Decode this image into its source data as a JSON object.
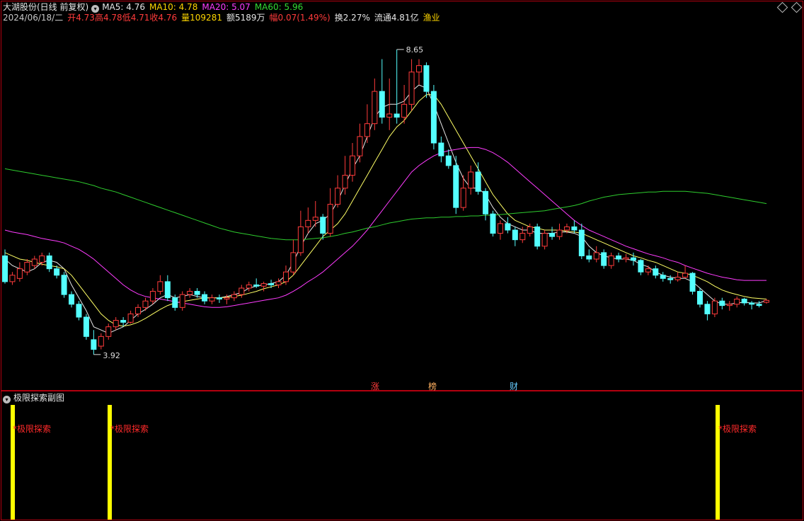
{
  "header": {
    "title": "大湖股份(日线 前复权)",
    "ma5": "MA5: 4.76",
    "ma10": "MA10: 4.78",
    "ma20": "MA20: 5.07",
    "ma60": "MA60: 5.96",
    "date": "2024/06/18/二",
    "open": "开4.73",
    "high": "高4.78",
    "low": "低4.71",
    "close": "收4.76",
    "volume": "量109281",
    "amount": "额5189万",
    "change": "幅0.07(1.49%)",
    "turnover": "换2.27%",
    "float": "流通4.81亿",
    "sector": "渔业"
  },
  "markers": {
    "zhang": "涨",
    "bang": "榜",
    "cai": "财"
  },
  "subchart": {
    "title": "极限探索副图",
    "signal_label": "*极限探索"
  },
  "colors": {
    "up": "#ff3b3b",
    "down": "#54ffff",
    "ma5": "#e8e8e8",
    "ma10": "#ffff66",
    "ma20": "#ff3cff",
    "ma60": "#2ecc2e",
    "signal": "#ffff00",
    "frame": "#b3000f"
  },
  "chart_data": {
    "type": "candlestick",
    "y_range": [
      3.6,
      9.0
    ],
    "annotations": {
      "max": 8.65,
      "min": 3.92
    },
    "candles": [
      [
        5.45,
        5.05,
        5.55,
        5.02
      ],
      [
        5.05,
        5.15,
        5.2,
        5.0
      ],
      [
        5.1,
        5.25,
        5.35,
        5.05
      ],
      [
        5.2,
        5.35,
        5.4,
        5.15
      ],
      [
        5.3,
        5.4,
        5.45,
        5.25
      ],
      [
        5.35,
        5.45,
        5.5,
        5.3
      ],
      [
        5.45,
        5.25,
        5.5,
        5.2
      ],
      [
        5.25,
        5.15,
        5.3,
        5.1
      ],
      [
        5.15,
        4.85,
        5.2,
        4.8
      ],
      [
        4.85,
        4.7,
        4.9,
        4.65
      ],
      [
        4.7,
        4.5,
        4.75,
        4.45
      ],
      [
        4.5,
        4.2,
        4.55,
        4.15
      ],
      [
        4.15,
        4.0,
        4.3,
        3.92
      ],
      [
        4.05,
        4.2,
        4.25,
        4.0
      ],
      [
        4.2,
        4.35,
        4.4,
        4.15
      ],
      [
        4.35,
        4.45,
        4.5,
        4.3
      ],
      [
        4.45,
        4.42,
        4.5,
        4.35
      ],
      [
        4.42,
        4.55,
        4.6,
        4.4
      ],
      [
        4.55,
        4.65,
        4.7,
        4.5
      ],
      [
        4.65,
        4.75,
        4.8,
        4.6
      ],
      [
        4.75,
        4.9,
        4.95,
        4.7
      ],
      [
        4.9,
        5.05,
        5.15,
        4.85
      ],
      [
        5.05,
        4.8,
        5.15,
        4.75
      ],
      [
        4.8,
        4.65,
        4.85,
        4.6
      ],
      [
        4.65,
        4.85,
        4.9,
        4.6
      ],
      [
        4.85,
        4.9,
        4.95,
        4.8
      ],
      [
        4.9,
        4.85,
        4.95,
        4.8
      ],
      [
        4.85,
        4.75,
        4.9,
        4.7
      ],
      [
        4.75,
        4.8,
        4.85,
        4.7
      ],
      [
        4.8,
        4.78,
        4.85,
        4.72
      ],
      [
        4.78,
        4.8,
        4.85,
        4.7
      ],
      [
        4.8,
        4.85,
        4.9,
        4.75
      ],
      [
        4.85,
        4.95,
        5.0,
        4.8
      ],
      [
        4.95,
        5.0,
        5.05,
        4.9
      ],
      [
        5.0,
        4.98,
        5.1,
        4.95
      ],
      [
        4.98,
        5.02,
        5.05,
        4.9
      ],
      [
        5.02,
        5.0,
        5.08,
        4.95
      ],
      [
        5.0,
        5.05,
        5.1,
        4.95
      ],
      [
        5.05,
        5.2,
        5.3,
        5.0
      ],
      [
        5.2,
        5.5,
        5.7,
        5.15
      ],
      [
        5.5,
        5.9,
        6.15,
        5.45
      ],
      [
        5.9,
        6.0,
        6.2,
        5.8
      ],
      [
        6.0,
        6.05,
        6.3,
        5.9
      ],
      [
        6.05,
        5.8,
        6.1,
        5.7
      ],
      [
        5.8,
        6.25,
        6.5,
        5.75
      ],
      [
        6.25,
        6.5,
        6.7,
        6.2
      ],
      [
        6.5,
        6.7,
        7.0,
        6.4
      ],
      [
        6.7,
        7.0,
        7.2,
        6.6
      ],
      [
        7.0,
        7.3,
        7.5,
        6.9
      ],
      [
        7.3,
        7.5,
        7.8,
        7.2
      ],
      [
        7.5,
        8.0,
        8.2,
        7.4
      ],
      [
        8.0,
        7.6,
        8.5,
        7.5
      ],
      [
        7.6,
        7.65,
        8.2,
        7.4
      ],
      [
        7.65,
        7.6,
        8.65,
        7.5
      ],
      [
        7.6,
        7.8,
        8.1,
        7.5
      ],
      [
        7.8,
        8.3,
        8.5,
        7.7
      ],
      [
        8.3,
        8.4,
        8.5,
        8.1
      ],
      [
        8.4,
        8.0,
        8.45,
        7.9
      ],
      [
        8.0,
        7.2,
        8.1,
        7.1
      ],
      [
        7.2,
        7.0,
        7.3,
        6.9
      ],
      [
        7.0,
        6.85,
        7.1,
        6.8
      ],
      [
        6.85,
        6.2,
        7.0,
        6.1
      ],
      [
        6.2,
        6.5,
        6.7,
        6.15
      ],
      [
        6.5,
        6.75,
        6.85,
        6.4
      ],
      [
        6.75,
        6.45,
        6.9,
        6.4
      ],
      [
        6.45,
        6.1,
        6.5,
        6.0
      ],
      [
        6.1,
        5.8,
        6.15,
        5.75
      ],
      [
        5.8,
        5.95,
        6.0,
        5.7
      ],
      [
        5.95,
        5.85,
        6.05,
        5.8
      ],
      [
        5.85,
        5.7,
        5.9,
        5.6
      ],
      [
        5.7,
        5.8,
        5.9,
        5.65
      ],
      [
        5.8,
        5.9,
        5.95,
        5.75
      ],
      [
        5.9,
        5.6,
        5.95,
        5.55
      ],
      [
        5.6,
        5.8,
        5.85,
        5.55
      ],
      [
        5.8,
        5.75,
        5.9,
        5.7
      ],
      [
        5.75,
        5.85,
        5.95,
        5.7
      ],
      [
        5.85,
        5.9,
        5.95,
        5.8
      ],
      [
        5.9,
        5.85,
        6.0,
        5.8
      ],
      [
        5.85,
        5.45,
        5.95,
        5.4
      ],
      [
        5.45,
        5.4,
        5.55,
        5.35
      ],
      [
        5.4,
        5.5,
        5.6,
        5.35
      ],
      [
        5.5,
        5.3,
        5.55,
        5.25
      ],
      [
        5.3,
        5.45,
        5.5,
        5.25
      ],
      [
        5.45,
        5.4,
        5.5,
        5.35
      ],
      [
        5.4,
        5.42,
        5.48,
        5.35
      ],
      [
        5.42,
        5.38,
        5.5,
        5.3
      ],
      [
        5.38,
        5.2,
        5.4,
        5.15
      ],
      [
        5.2,
        5.25,
        5.3,
        5.15
      ],
      [
        5.25,
        5.15,
        5.3,
        5.1
      ],
      [
        5.15,
        5.1,
        5.2,
        5.05
      ],
      [
        5.1,
        5.08,
        5.15,
        5.02
      ],
      [
        5.08,
        5.12,
        5.2,
        5.05
      ],
      [
        5.12,
        5.18,
        5.3,
        5.1
      ],
      [
        5.18,
        4.9,
        5.2,
        4.85
      ],
      [
        4.9,
        4.7,
        4.95,
        4.65
      ],
      [
        4.7,
        4.55,
        4.75,
        4.45
      ],
      [
        4.55,
        4.75,
        4.8,
        4.5
      ],
      [
        4.75,
        4.68,
        4.8,
        4.62
      ],
      [
        4.68,
        4.7,
        4.75,
        4.6
      ],
      [
        4.7,
        4.78,
        4.82,
        4.65
      ],
      [
        4.78,
        4.72,
        4.8,
        4.68
      ],
      [
        4.72,
        4.7,
        4.75,
        4.62
      ],
      [
        4.7,
        4.68,
        4.75,
        4.65
      ],
      [
        4.73,
        4.76,
        4.78,
        4.71
      ]
    ],
    "ma_lines": [
      {
        "name": "MA5",
        "values": [
          5.4,
          5.3,
          5.25,
          5.2,
          5.25,
          5.35,
          5.38,
          5.35,
          5.25,
          5.0,
          4.8,
          4.6,
          4.35,
          4.3,
          4.25,
          4.3,
          4.35,
          4.45,
          4.55,
          4.62,
          4.7,
          4.8,
          4.85,
          4.8,
          4.82,
          4.85,
          4.82,
          4.8,
          4.8,
          4.8,
          4.82,
          4.85,
          4.88,
          4.95,
          4.98,
          5.0,
          5.02,
          5.05,
          5.15,
          5.35,
          5.6,
          5.8,
          5.95,
          6.0,
          6.1,
          6.3,
          6.55,
          6.8,
          7.0,
          7.3,
          7.6,
          7.75,
          7.8,
          7.8,
          7.85,
          8.0,
          8.1,
          8.05,
          7.8,
          7.5,
          7.2,
          6.9,
          6.65,
          6.5,
          6.5,
          6.4,
          6.2,
          6.05,
          5.95,
          5.9,
          5.85,
          5.85,
          5.8,
          5.8,
          5.8,
          5.82,
          5.82,
          5.8,
          5.75,
          5.6,
          5.5,
          5.45,
          5.42,
          5.4,
          5.4,
          5.38,
          5.32,
          5.28,
          5.2,
          5.15,
          5.12,
          5.1,
          5.1,
          5.05,
          4.95,
          4.85,
          4.75,
          4.7,
          4.7,
          4.72,
          4.73,
          4.72,
          4.72,
          4.76
        ]
      },
      {
        "name": "MA10",
        "values": [
          5.5,
          5.45,
          5.4,
          5.38,
          5.35,
          5.32,
          5.3,
          5.28,
          5.25,
          5.15,
          5.0,
          4.85,
          4.7,
          4.55,
          4.45,
          4.38,
          4.36,
          4.38,
          4.42,
          4.48,
          4.55,
          4.62,
          4.68,
          4.72,
          4.74,
          4.76,
          4.78,
          4.8,
          4.8,
          4.8,
          4.81,
          4.82,
          4.84,
          4.87,
          4.9,
          4.94,
          4.97,
          5.0,
          5.05,
          5.15,
          5.3,
          5.45,
          5.6,
          5.75,
          5.85,
          5.95,
          6.1,
          6.3,
          6.5,
          6.7,
          6.9,
          7.1,
          7.3,
          7.45,
          7.55,
          7.7,
          7.85,
          7.95,
          7.95,
          7.8,
          7.6,
          7.4,
          7.2,
          7.0,
          6.8,
          6.6,
          6.4,
          6.25,
          6.1,
          6.0,
          5.95,
          5.9,
          5.88,
          5.85,
          5.85,
          5.85,
          5.83,
          5.82,
          5.8,
          5.75,
          5.7,
          5.65,
          5.6,
          5.55,
          5.5,
          5.45,
          5.42,
          5.38,
          5.35,
          5.3,
          5.25,
          5.2,
          5.18,
          5.15,
          5.1,
          5.05,
          4.98,
          4.92,
          4.88,
          4.85,
          4.82,
          4.8,
          4.79,
          4.78
        ]
      },
      {
        "name": "MA20",
        "values": [
          5.85,
          5.82,
          5.8,
          5.78,
          5.75,
          5.72,
          5.7,
          5.68,
          5.65,
          5.6,
          5.55,
          5.48,
          5.4,
          5.3,
          5.2,
          5.1,
          5.0,
          4.92,
          4.86,
          4.82,
          4.8,
          4.78,
          4.76,
          4.74,
          4.72,
          4.7,
          4.68,
          4.66,
          4.65,
          4.65,
          4.66,
          4.68,
          4.7,
          4.72,
          4.74,
          4.76,
          4.78,
          4.8,
          4.84,
          4.9,
          4.97,
          5.05,
          5.12,
          5.2,
          5.3,
          5.4,
          5.5,
          5.6,
          5.72,
          5.85,
          6.0,
          6.15,
          6.3,
          6.45,
          6.6,
          6.75,
          6.85,
          6.93,
          7.0,
          7.05,
          7.08,
          7.1,
          7.12,
          7.13,
          7.13,
          7.1,
          7.05,
          6.98,
          6.9,
          6.8,
          6.7,
          6.6,
          6.5,
          6.4,
          6.3,
          6.2,
          6.1,
          6.0,
          5.92,
          5.85,
          5.8,
          5.75,
          5.7,
          5.65,
          5.6,
          5.56,
          5.52,
          5.48,
          5.45,
          5.42,
          5.38,
          5.35,
          5.3,
          5.26,
          5.22,
          5.18,
          5.15,
          5.12,
          5.1,
          5.08,
          5.07,
          5.07,
          5.07,
          5.07
        ]
      },
      {
        "name": "MA60",
        "values": [
          6.8,
          6.78,
          6.76,
          6.74,
          6.72,
          6.7,
          6.68,
          6.66,
          6.64,
          6.62,
          6.6,
          6.57,
          6.54,
          6.5,
          6.47,
          6.44,
          6.4,
          6.36,
          6.32,
          6.28,
          6.24,
          6.2,
          6.16,
          6.12,
          6.08,
          6.04,
          6.0,
          5.96,
          5.92,
          5.88,
          5.85,
          5.82,
          5.8,
          5.78,
          5.76,
          5.74,
          5.72,
          5.71,
          5.7,
          5.7,
          5.7,
          5.71,
          5.72,
          5.73,
          5.75,
          5.77,
          5.8,
          5.82,
          5.85,
          5.88,
          5.9,
          5.93,
          5.96,
          5.98,
          6.0,
          6.02,
          6.03,
          6.04,
          6.04,
          6.05,
          6.05,
          6.06,
          6.06,
          6.07,
          6.07,
          6.08,
          6.08,
          6.09,
          6.1,
          6.11,
          6.12,
          6.13,
          6.14,
          6.15,
          6.17,
          6.19,
          6.21,
          6.23,
          6.26,
          6.3,
          6.33,
          6.36,
          6.38,
          6.4,
          6.41,
          6.42,
          6.43,
          6.44,
          6.44,
          6.45,
          6.45,
          6.45,
          6.45,
          6.44,
          6.43,
          6.42,
          6.4,
          6.38,
          6.36,
          6.34,
          6.32,
          6.3,
          6.28,
          6.26
        ]
      }
    ],
    "signals_at_index": [
      1,
      13,
      100
    ]
  }
}
